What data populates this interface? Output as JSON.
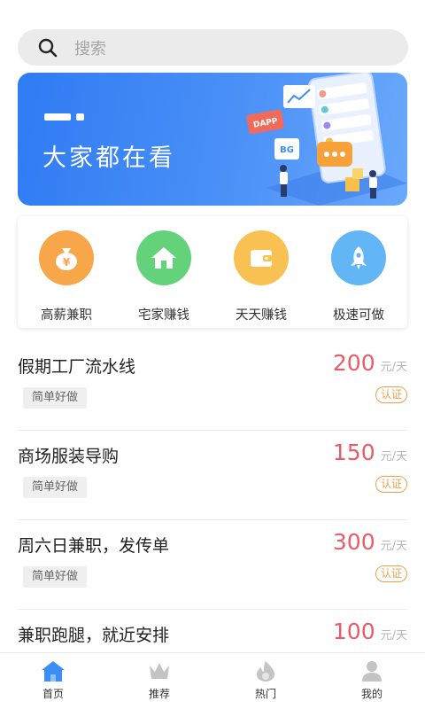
{
  "search": {
    "placeholder": "搜索",
    "icon": "search-icon"
  },
  "banner": {
    "title": "大家都在看",
    "badges": [
      "DAPP",
      "BG"
    ]
  },
  "categories": [
    {
      "label": "高薪兼职",
      "icon": "money-bag-icon",
      "color": "#f7a64a"
    },
    {
      "label": "宅家赚钱",
      "icon": "home-icon",
      "color": "#64d27a"
    },
    {
      "label": "天天赚钱",
      "icon": "wallet-icon",
      "color": "#f9c052"
    },
    {
      "label": "极速可做",
      "icon": "rocket-icon",
      "color": "#62b6f6"
    }
  ],
  "jobs": [
    {
      "title": "假期工厂流水线",
      "tag": "简单好做",
      "price": "200",
      "unit": "元/天",
      "badge": "认证"
    },
    {
      "title": "商场服装导购",
      "tag": "简单好做",
      "price": "150",
      "unit": "元/天",
      "badge": "认证"
    },
    {
      "title": "周六日兼职，发传单",
      "tag": "简单好做",
      "price": "300",
      "unit": "元/天",
      "badge": "认证"
    },
    {
      "title": "兼职跑腿，就近安排",
      "tag": "",
      "price": "100",
      "unit": "元/天",
      "badge": ""
    }
  ],
  "tabs": [
    {
      "label": "首页",
      "icon": "home-tab-icon",
      "active": true
    },
    {
      "label": "推荐",
      "icon": "crown-icon",
      "active": false
    },
    {
      "label": "热门",
      "icon": "fire-icon",
      "active": false
    },
    {
      "label": "我的",
      "icon": "user-icon",
      "active": false
    }
  ],
  "colors": {
    "accent": "#3a8ef5",
    "price": "#e85c6a",
    "cert": "#f0a04a",
    "tab_inactive": "#c4c4c4"
  }
}
